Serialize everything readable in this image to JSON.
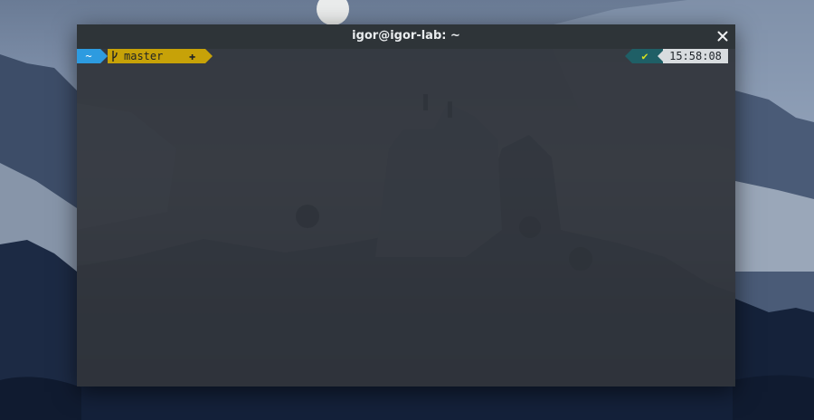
{
  "window": {
    "title": "igor@igor-lab: ~"
  },
  "prompt": {
    "directory": "~",
    "git_branch": "master",
    "git_status_symbol": "✚",
    "exit_status_symbol": "✔",
    "time": "15:58:08"
  },
  "colors": {
    "directory_segment": "#2d9be0",
    "git_segment": "#c7a208",
    "status_segment": "#1f5f66",
    "time_segment": "#d8dcdf",
    "titlebar": "#2e3438"
  },
  "icons": {
    "close": "close-icon",
    "branch": "git-branch-icon"
  }
}
